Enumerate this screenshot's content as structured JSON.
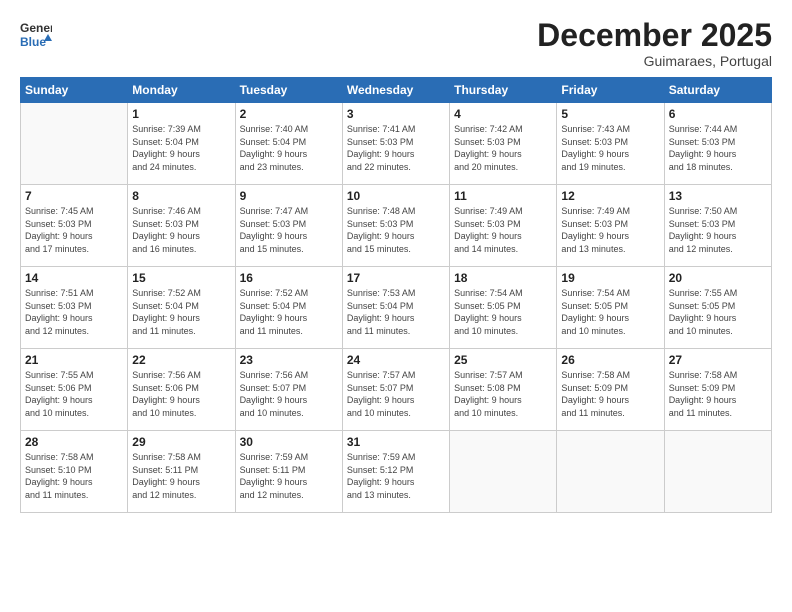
{
  "header": {
    "logo_line1": "General",
    "logo_line2": "Blue",
    "month_title": "December 2025",
    "subtitle": "Guimaraes, Portugal"
  },
  "weekdays": [
    "Sunday",
    "Monday",
    "Tuesday",
    "Wednesday",
    "Thursday",
    "Friday",
    "Saturday"
  ],
  "weeks": [
    [
      {
        "day": "",
        "info": ""
      },
      {
        "day": "1",
        "info": "Sunrise: 7:39 AM\nSunset: 5:04 PM\nDaylight: 9 hours\nand 24 minutes."
      },
      {
        "day": "2",
        "info": "Sunrise: 7:40 AM\nSunset: 5:04 PM\nDaylight: 9 hours\nand 23 minutes."
      },
      {
        "day": "3",
        "info": "Sunrise: 7:41 AM\nSunset: 5:03 PM\nDaylight: 9 hours\nand 22 minutes."
      },
      {
        "day": "4",
        "info": "Sunrise: 7:42 AM\nSunset: 5:03 PM\nDaylight: 9 hours\nand 20 minutes."
      },
      {
        "day": "5",
        "info": "Sunrise: 7:43 AM\nSunset: 5:03 PM\nDaylight: 9 hours\nand 19 minutes."
      },
      {
        "day": "6",
        "info": "Sunrise: 7:44 AM\nSunset: 5:03 PM\nDaylight: 9 hours\nand 18 minutes."
      }
    ],
    [
      {
        "day": "7",
        "info": "Sunrise: 7:45 AM\nSunset: 5:03 PM\nDaylight: 9 hours\nand 17 minutes."
      },
      {
        "day": "8",
        "info": "Sunrise: 7:46 AM\nSunset: 5:03 PM\nDaylight: 9 hours\nand 16 minutes."
      },
      {
        "day": "9",
        "info": "Sunrise: 7:47 AM\nSunset: 5:03 PM\nDaylight: 9 hours\nand 15 minutes."
      },
      {
        "day": "10",
        "info": "Sunrise: 7:48 AM\nSunset: 5:03 PM\nDaylight: 9 hours\nand 15 minutes."
      },
      {
        "day": "11",
        "info": "Sunrise: 7:49 AM\nSunset: 5:03 PM\nDaylight: 9 hours\nand 14 minutes."
      },
      {
        "day": "12",
        "info": "Sunrise: 7:49 AM\nSunset: 5:03 PM\nDaylight: 9 hours\nand 13 minutes."
      },
      {
        "day": "13",
        "info": "Sunrise: 7:50 AM\nSunset: 5:03 PM\nDaylight: 9 hours\nand 12 minutes."
      }
    ],
    [
      {
        "day": "14",
        "info": "Sunrise: 7:51 AM\nSunset: 5:03 PM\nDaylight: 9 hours\nand 12 minutes."
      },
      {
        "day": "15",
        "info": "Sunrise: 7:52 AM\nSunset: 5:04 PM\nDaylight: 9 hours\nand 11 minutes."
      },
      {
        "day": "16",
        "info": "Sunrise: 7:52 AM\nSunset: 5:04 PM\nDaylight: 9 hours\nand 11 minutes."
      },
      {
        "day": "17",
        "info": "Sunrise: 7:53 AM\nSunset: 5:04 PM\nDaylight: 9 hours\nand 11 minutes."
      },
      {
        "day": "18",
        "info": "Sunrise: 7:54 AM\nSunset: 5:05 PM\nDaylight: 9 hours\nand 10 minutes."
      },
      {
        "day": "19",
        "info": "Sunrise: 7:54 AM\nSunset: 5:05 PM\nDaylight: 9 hours\nand 10 minutes."
      },
      {
        "day": "20",
        "info": "Sunrise: 7:55 AM\nSunset: 5:05 PM\nDaylight: 9 hours\nand 10 minutes."
      }
    ],
    [
      {
        "day": "21",
        "info": "Sunrise: 7:55 AM\nSunset: 5:06 PM\nDaylight: 9 hours\nand 10 minutes."
      },
      {
        "day": "22",
        "info": "Sunrise: 7:56 AM\nSunset: 5:06 PM\nDaylight: 9 hours\nand 10 minutes."
      },
      {
        "day": "23",
        "info": "Sunrise: 7:56 AM\nSunset: 5:07 PM\nDaylight: 9 hours\nand 10 minutes."
      },
      {
        "day": "24",
        "info": "Sunrise: 7:57 AM\nSunset: 5:07 PM\nDaylight: 9 hours\nand 10 minutes."
      },
      {
        "day": "25",
        "info": "Sunrise: 7:57 AM\nSunset: 5:08 PM\nDaylight: 9 hours\nand 10 minutes."
      },
      {
        "day": "26",
        "info": "Sunrise: 7:58 AM\nSunset: 5:09 PM\nDaylight: 9 hours\nand 11 minutes."
      },
      {
        "day": "27",
        "info": "Sunrise: 7:58 AM\nSunset: 5:09 PM\nDaylight: 9 hours\nand 11 minutes."
      }
    ],
    [
      {
        "day": "28",
        "info": "Sunrise: 7:58 AM\nSunset: 5:10 PM\nDaylight: 9 hours\nand 11 minutes."
      },
      {
        "day": "29",
        "info": "Sunrise: 7:58 AM\nSunset: 5:11 PM\nDaylight: 9 hours\nand 12 minutes."
      },
      {
        "day": "30",
        "info": "Sunrise: 7:59 AM\nSunset: 5:11 PM\nDaylight: 9 hours\nand 12 minutes."
      },
      {
        "day": "31",
        "info": "Sunrise: 7:59 AM\nSunset: 5:12 PM\nDaylight: 9 hours\nand 13 minutes."
      },
      {
        "day": "",
        "info": ""
      },
      {
        "day": "",
        "info": ""
      },
      {
        "day": "",
        "info": ""
      }
    ]
  ]
}
